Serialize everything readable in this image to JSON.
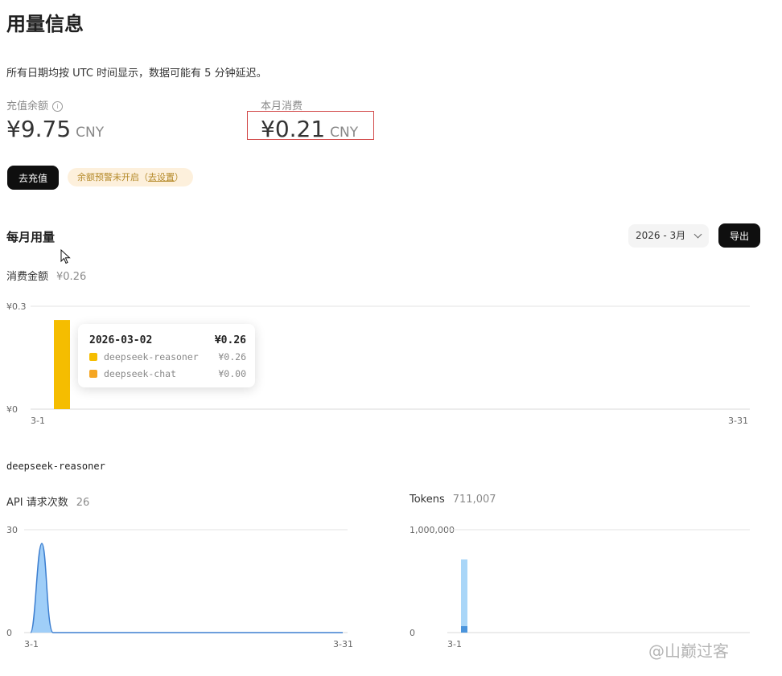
{
  "page": {
    "title": "用量信息",
    "note": "所有日期均按 UTC 时间显示，数据可能有 5 分钟延迟。"
  },
  "balance": {
    "label": "充值余额",
    "info_icon": "info-icon",
    "amount": "¥9.75",
    "unit": "CNY"
  },
  "month_spend": {
    "label": "本月消费",
    "amount": "¥0.21",
    "unit": "CNY"
  },
  "actions": {
    "topup_label": "去充值",
    "alert_text": "余额预警未开启（",
    "alert_link": "去设置",
    "alert_close": "）"
  },
  "monthly": {
    "title": "每月用量",
    "month_select": "2026 - 3月",
    "export_label": "导出",
    "spend_label": "消费金额",
    "spend_value": "¥0.26"
  },
  "spend_chart": {
    "y_top": "¥0.3",
    "y_bottom": "¥0",
    "x_start": "3-1",
    "x_end": "3-31"
  },
  "tooltip": {
    "date": "2026-03-02",
    "total": "¥0.26",
    "rows": [
      {
        "name": "deepseek-reasoner",
        "value": "¥0.26",
        "color": "#f5bd00"
      },
      {
        "name": "deepseek-chat",
        "value": "¥0.00",
        "color": "#f5a623"
      }
    ]
  },
  "model": {
    "name": "deepseek-reasoner"
  },
  "requests": {
    "label": "API 请求次数",
    "value": "26",
    "y_top": "30",
    "y_bottom": "0",
    "x_start": "3-1",
    "x_end": "3-31"
  },
  "tokens": {
    "label": "Tokens",
    "value": "711,007",
    "y_top": "1,000,000",
    "y_bottom": "0",
    "x_start": "3-1"
  },
  "chart_data": [
    {
      "type": "bar",
      "x": [
        "3-1",
        "3-2"
      ],
      "series": [
        {
          "name": "deepseek-reasoner",
          "values": [
            0.26,
            0
          ],
          "color": "#f5bd00"
        },
        {
          "name": "deepseek-chat",
          "values": [
            0.0,
            0
          ],
          "color": "#f5a623"
        }
      ],
      "ylabel": "",
      "ylim": [
        0,
        0.3
      ],
      "x_range": [
        "3-1",
        "3-31"
      ]
    },
    {
      "type": "area",
      "x": [
        "3-1",
        "3-2",
        "3-3"
      ],
      "values": [
        0,
        26,
        0
      ],
      "ylim": [
        0,
        30
      ],
      "x_range": [
        "3-1",
        "3-31"
      ]
    },
    {
      "type": "bar",
      "x": [
        "3-2"
      ],
      "values": [
        711007
      ],
      "ylim": [
        0,
        1000000
      ]
    }
  ],
  "watermark": "@山巅过客",
  "colors": {
    "accent": "#0f0f0f",
    "bar_yellow": "#f5bd00",
    "area_blue": "#8ec5f7",
    "highlight_box": "#d24a4a"
  }
}
